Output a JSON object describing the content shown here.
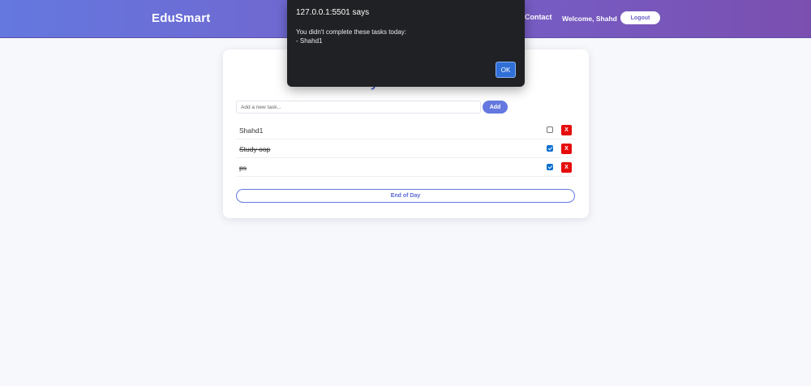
{
  "header": {
    "brand": "EduSmart",
    "nav_contact": "Contact",
    "welcome": "Welcome, Shahd",
    "logout_label": "Logout"
  },
  "planner": {
    "title": "Daily Task Planner",
    "input_placeholder": "Add a new task...",
    "add_label": "Add",
    "tasks": [
      {
        "text": "Shahd1",
        "done": false,
        "delete_label": "X"
      },
      {
        "text": "Study oop",
        "done": true,
        "delete_label": "X"
      },
      {
        "text": "ps",
        "done": true,
        "delete_label": "X"
      }
    ],
    "end_of_day_label": "End of Day"
  },
  "dialog": {
    "title": "127.0.0.1:5501 says",
    "message": "You didn't complete these tasks today:\n- Shahd1",
    "ok_label": "OK"
  },
  "colors": {
    "accent": "#6478df",
    "header_gradient_end": "#7a4fb0",
    "delete": "#e60c0c",
    "dialog_bg": "#202124"
  }
}
